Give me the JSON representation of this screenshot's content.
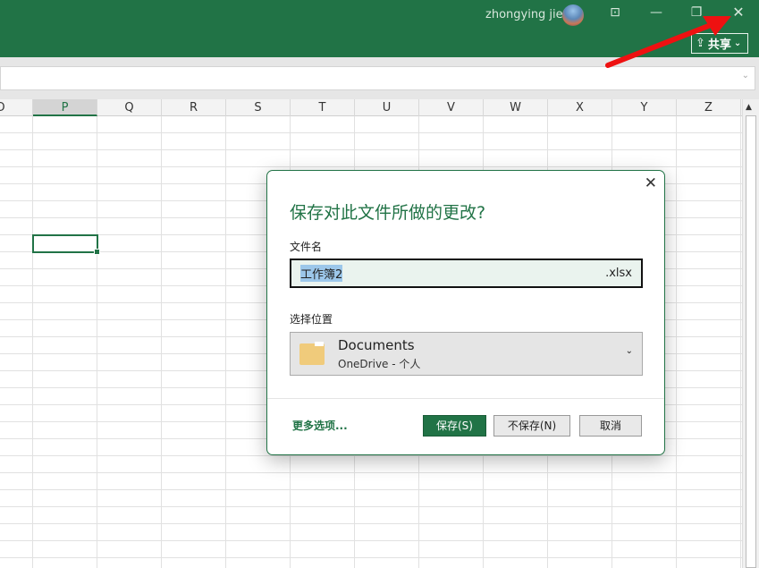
{
  "titlebar": {
    "user": "zhongying jie",
    "share_label": "共享",
    "share_chevron": "⌄"
  },
  "window_buttons": {
    "ribbon": "⊡",
    "minimize": "—",
    "restore": "❐",
    "close": "✕"
  },
  "columns": [
    "O",
    "P",
    "Q",
    "R",
    "S",
    "T",
    "U",
    "V",
    "W",
    "X",
    "Y",
    "Z"
  ],
  "selected_column": "P",
  "dialog": {
    "title": "保存对此文件所做的更改?",
    "filename_label": "文件名",
    "filename_value": "工作簿2",
    "extension": ".xlsx",
    "location_label": "选择位置",
    "location_name": "Documents",
    "location_sub": "OneDrive - 个人",
    "more_options": "更多选项...",
    "save": "保存(S)",
    "dont_save": "不保存(N)",
    "cancel": "取消",
    "close": "✕",
    "chevron": "⌄"
  },
  "annotation_color": "#ee1111"
}
